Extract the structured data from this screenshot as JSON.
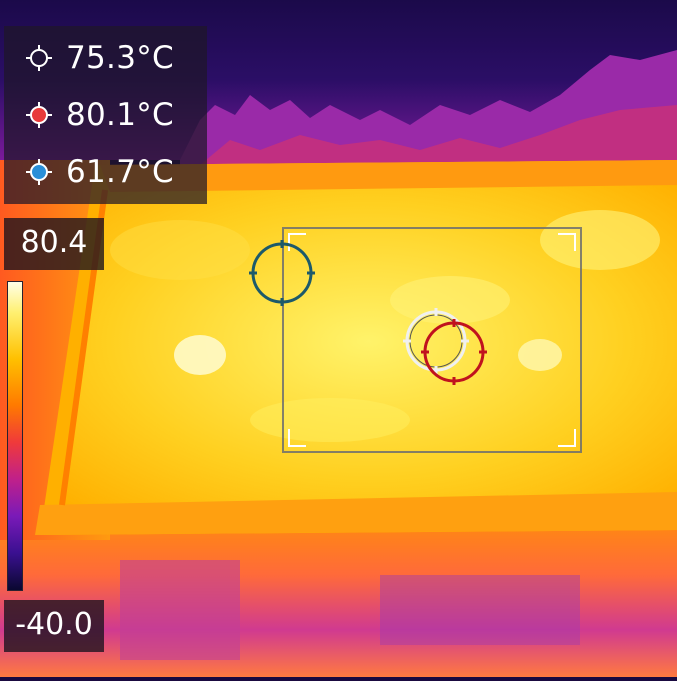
{
  "thermal_view": {
    "palette": "iron",
    "measurements": [
      {
        "label": "75.3°C",
        "icon": "center-spot-crosshair-icon",
        "color": "#ffffff"
      },
      {
        "label": "80.1°C",
        "icon": "hot-spot-crosshair-icon",
        "color": "#e83a3a"
      },
      {
        "label": "61.7°C",
        "icon": "cold-spot-crosshair-icon",
        "color": "#2a8fd8"
      }
    ],
    "scale": {
      "max_label": "80.4",
      "min_label": "-40.0"
    },
    "colors": {
      "hot_marker": "#c0121e",
      "cold_marker": "#1d5a6a",
      "center_marker": "#f0f0f0"
    }
  }
}
